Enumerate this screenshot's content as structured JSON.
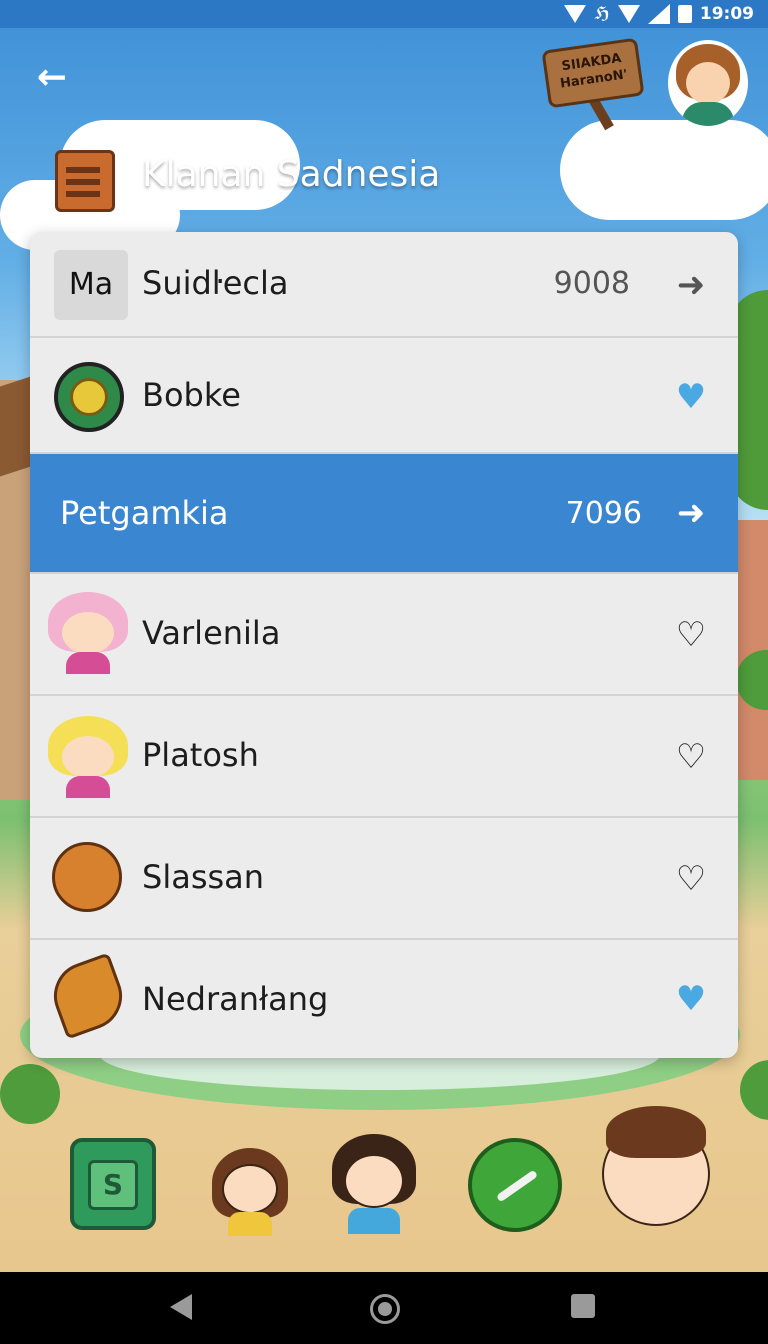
{
  "status_bar": {
    "time": "19:09",
    "extra": "ℌ"
  },
  "header": {
    "title": "Klanan Sadnesia",
    "sign_line1": "SIIAKDA",
    "sign_line2": "HaranoN'",
    "back_icon": "arrow-back-icon"
  },
  "rows": [
    {
      "thumb_text": "Ma",
      "name": "Suidŀecla",
      "count": "9008",
      "action_icon": "arrow-right-icon",
      "selected": false
    },
    {
      "name": "Bobke",
      "action_icon": "heart-filled-icon",
      "selected": false
    },
    {
      "name": "Petgamkia",
      "count": "7096",
      "action_icon": "arrow-right-icon",
      "selected": true
    },
    {
      "name": "Varlenila",
      "action_icon": "heart-outline-icon",
      "selected": false
    },
    {
      "name": "Platosh",
      "action_icon": "heart-outline-icon",
      "selected": false
    },
    {
      "name": "Slassan",
      "action_icon": "heart-outline-icon",
      "selected": false
    },
    {
      "name": "Nedranłang",
      "action_icon": "heart-filled-icon",
      "selected": false
    }
  ],
  "bottom_bar": {
    "box_letter": "S"
  },
  "colors": {
    "selected_row": "#3b86d1",
    "heart_blue": "#4aa8e2",
    "status_bar": "#2c78c4"
  }
}
